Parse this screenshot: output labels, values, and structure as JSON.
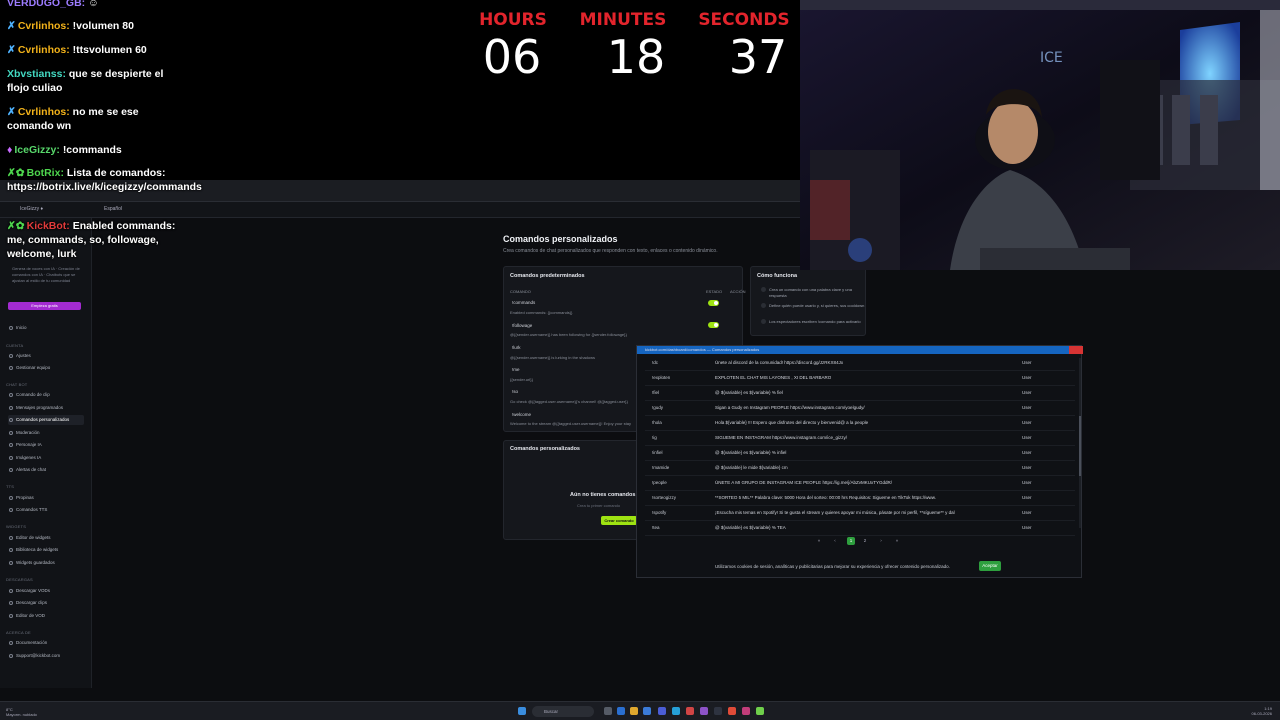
{
  "chat": {
    "messages": [
      {
        "user": "VERDUGO_GB:",
        "text": "",
        "user_color": "#9d7cff",
        "badge": "☺"
      },
      {
        "user": "Cvrlinhos:",
        "text": "!volumen 80",
        "user_color": "#f2b21a",
        "badge": "✗"
      },
      {
        "user": "Cvrlinhos:",
        "text": "!ttsvolumen 60",
        "user_color": "#f2b21a",
        "badge": "✗"
      },
      {
        "user": "Xbvstianss:",
        "text": "que se despierte el flojo culiao",
        "user_color": "#43d9c2",
        "badge": ""
      },
      {
        "user": "Cvrlinhos:",
        "text": "no me se ese comando wn",
        "user_color": "#f2b21a",
        "badge": "✗"
      },
      {
        "user": "IceGizzy:",
        "text": "!commands",
        "user_color": "#58d86b",
        "badge": "♦"
      },
      {
        "user": "BotRix:",
        "text": "Lista de comandos: https://botrix.live/k/icegizzy/commands",
        "user_color": "#4ed64e",
        "badge": "✗✿"
      },
      {
        "user": "KickBot:",
        "text": "Enabled commands: me, commands, so, followage, welcome, lurk",
        "user_color": "#e23b3b",
        "badge": "✗✿"
      }
    ]
  },
  "timer": {
    "hours_label": "HOURS",
    "minutes_label": "MINUTES",
    "seconds_label": "SECONDS",
    "hours": "06",
    "minutes": "18",
    "seconds": "37"
  },
  "browser": {
    "url": "kickbot.com/dashboard/comandos",
    "user": "IceGizzy ♦",
    "language": "Español"
  },
  "sidebar": {
    "description": "Genera de voces con IA · Creación de comandos con IA · Chatbots que se ajustan al estilo de tu comunidad",
    "promo": "Empieza gratis",
    "sections": [
      "Cuenta",
      "Chat bot",
      "TTS",
      "Widgets",
      "Descargas",
      "Acerca de"
    ],
    "items": {
      "inicio": "Inicio",
      "ajustes": "Ajustes",
      "equipo": "Gestionar equipo",
      "clip": "Comando de clip",
      "mensajes": "Mensajes programados",
      "comandos": "Comandos personalizados",
      "moderacion": "Moderación",
      "personaje": "Personaje IA",
      "imagenes": "Imágenes IA",
      "alertas": "Alertas de chat",
      "propinas": "Propinas",
      "comandos_tts": "Comandos TTS",
      "editor_widgets": "Editor de widgets",
      "biblioteca": "Biblioteca de widgets",
      "guardados": "Widgets guardados",
      "vods": "Descargar VODs",
      "clips": "Descargar clips",
      "editor_vod": "Editor de VOD",
      "docs": "Documentación",
      "support": "Support@kickbot.com"
    }
  },
  "main": {
    "title": "Comandos personalizados",
    "subtitle": "Crea comandos de chat personalizados que responden con texto, enlaces o contenido dinámico.",
    "predefined_title": "Comandos predeterminados",
    "col_command": "COMANDO",
    "col_state": "ESTADO",
    "col_action": "ACCIÓN",
    "predefined": [
      {
        "name": "!commands",
        "text": "Enabled commands: {{commands}}"
      },
      {
        "name": "!followage",
        "text": "@{{sender.username}} has been following for {{sender.followage}}"
      },
      {
        "name": "!lurk",
        "text": "@{{sender.username}} is lurking in the shadows"
      },
      {
        "name": "!me",
        "text": "{{sender.url}}"
      },
      {
        "name": "!so",
        "text": "Go check @{{tagged.user.username}}'s channel! @{{tagged.user}}"
      },
      {
        "name": "!welcome",
        "text": "Welcome to the stream @{{tagged.user.username}}! Enjoy your stay"
      }
    ],
    "how_title": "Cómo funciona",
    "how_steps": [
      "Crea un comando con una palabra clave y una respuesta",
      "Define quién puede usarlo y, si quieres, sus cooldown",
      "Los espectadores escriben !comando para activarlo"
    ],
    "custom_title": "Comandos personalizados",
    "empty_title": "Aún no tienes comandos",
    "empty_sub": "Crea tu primer comando",
    "create_btn": "Crear comando"
  },
  "popup": {
    "title": "kickbot.com/dashboard/comandos — Comandos personalizados",
    "rows": [
      {
        "cmd": "!dc",
        "resp": "Únete al discord de la comunidad! https://discord.gg/JzRKX84Jx",
        "role": "User"
      },
      {
        "cmd": "!exploten",
        "resp": "EXPLOTEN EL CHAT MIS LAYONES , XI DEL BARBARO",
        "role": "User"
      },
      {
        "cmd": "!fiel",
        "resp": "@ ${variable} es ${variable} % fiel",
        "role": "User"
      },
      {
        "cmd": "!gudy",
        "resp": "Sigan a Gudy en Instagram PEOPLE https://www.instagram.com/yoelgudy/",
        "role": "User"
      },
      {
        "cmd": "!hola",
        "resp": "Hola ${variable} !!! Espero que disfrutes del directo y bienvenid@ a la people",
        "role": "User"
      },
      {
        "cmd": "!ig",
        "resp": "SIGUEME EN INSTAGRAM https://www.instagram.com/ice_gizzy/",
        "role": "User"
      },
      {
        "cmd": "!infiel",
        "resp": "@ ${variable} es ${variable} % infiel",
        "role": "User"
      },
      {
        "cmd": "!mamide",
        "resp": "@ ${variable} le mide ${variable} cm",
        "role": "User"
      },
      {
        "cmd": "!people",
        "resp": "ÚNETE A MI GRUPO DE INSTAGRAM ICE PEOPLE https://ig.me/j/AbZvMKUxTYGddR/",
        "role": "User"
      },
      {
        "cmd": "!sorteogizzy",
        "resp": "**SORTEO 5 MIL** Palabra clave: 5000 Hora del sorteo: 00:00 hrs Requisitos: Sigueme en TikTok https://www.",
        "role": "User"
      },
      {
        "cmd": "!spotify",
        "resp": "¡Escucha mis temas en Spotify! Si te gusta el stream y quieres apoyar mi música, pásate por mi perfil, **sígueme** y dal",
        "role": "User"
      },
      {
        "cmd": "!tea",
        "resp": "@ ${variable} es ${variable} % TEA",
        "role": "User"
      }
    ],
    "pages": [
      "«",
      "‹",
      "1",
      "2",
      "›",
      "»"
    ],
    "cookie_text": "Utilizamos cookies de sesión, analíticas y publicitarias para mejorar su experiencia y ofrecer contenido personalizado.",
    "cookie_btn": "Aceptar"
  },
  "taskbar": {
    "weather_temp": "8°C",
    "weather_desc": "Mayorm. nublado",
    "search": "Buscar",
    "lang": "ESP\nLAA",
    "time": "1:19",
    "date": "06-03-2026"
  }
}
